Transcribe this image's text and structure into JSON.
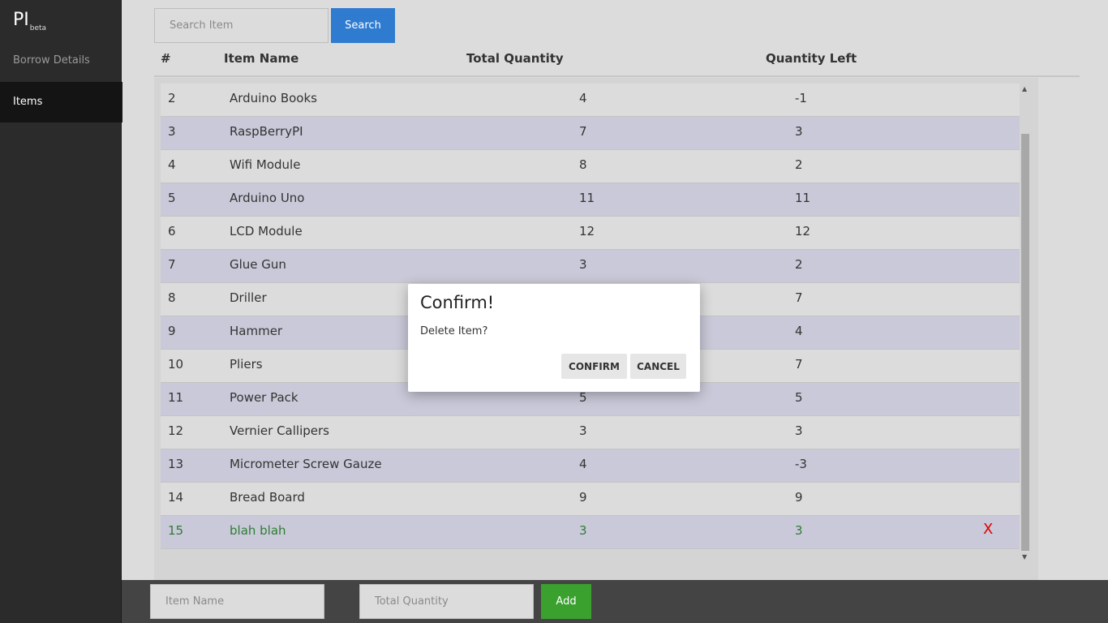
{
  "sidebar": {
    "brand": "PI",
    "brand_suffix": "beta",
    "items": [
      {
        "label": "Borrow Details"
      },
      {
        "label": "Items"
      }
    ]
  },
  "search": {
    "placeholder": "Search Item",
    "button_label": "Search"
  },
  "table": {
    "columns": [
      "#",
      "Item Name",
      "Total Quantity",
      "Quantity Left"
    ],
    "rows": [
      {
        "num": "2",
        "name": "Arduino Books",
        "total": "4",
        "left": "-1"
      },
      {
        "num": "3",
        "name": "RaspBerryPI",
        "total": "7",
        "left": "3"
      },
      {
        "num": "4",
        "name": "Wifi Module",
        "total": "8",
        "left": "2"
      },
      {
        "num": "5",
        "name": "Arduino Uno",
        "total": "11",
        "left": "11"
      },
      {
        "num": "6",
        "name": "LCD Module",
        "total": "12",
        "left": "12"
      },
      {
        "num": "7",
        "name": "Glue Gun",
        "total": "3",
        "left": "2"
      },
      {
        "num": "8",
        "name": "Driller",
        "total": "",
        "left": "7"
      },
      {
        "num": "9",
        "name": "Hammer",
        "total": "",
        "left": "4"
      },
      {
        "num": "10",
        "name": "Pliers",
        "total": "",
        "left": "7"
      },
      {
        "num": "11",
        "name": "Power Pack",
        "total": "5",
        "left": "5"
      },
      {
        "num": "12",
        "name": "Vernier Callipers",
        "total": "3",
        "left": "3"
      },
      {
        "num": "13",
        "name": "Micrometer Screw Gauze",
        "total": "4",
        "left": "-3"
      },
      {
        "num": "14",
        "name": "Bread Board",
        "total": "9",
        "left": "9"
      },
      {
        "num": "15",
        "name": "blah blah",
        "total": "3",
        "left": "3",
        "delete": "X"
      }
    ]
  },
  "add_form": {
    "item_name_placeholder": "Item Name",
    "total_quantity_placeholder": "Total Quantity",
    "add_label": "Add"
  },
  "dialog": {
    "title": "Confirm!",
    "message": "Delete Item?",
    "confirm_label": "CONFIRM",
    "cancel_label": "CANCEL"
  },
  "colors": {
    "search_button": "#2f7bd0",
    "add_button": "#3aa12f",
    "highlight_row_text": "#2e7d32",
    "delete_x": "#e00000"
  }
}
